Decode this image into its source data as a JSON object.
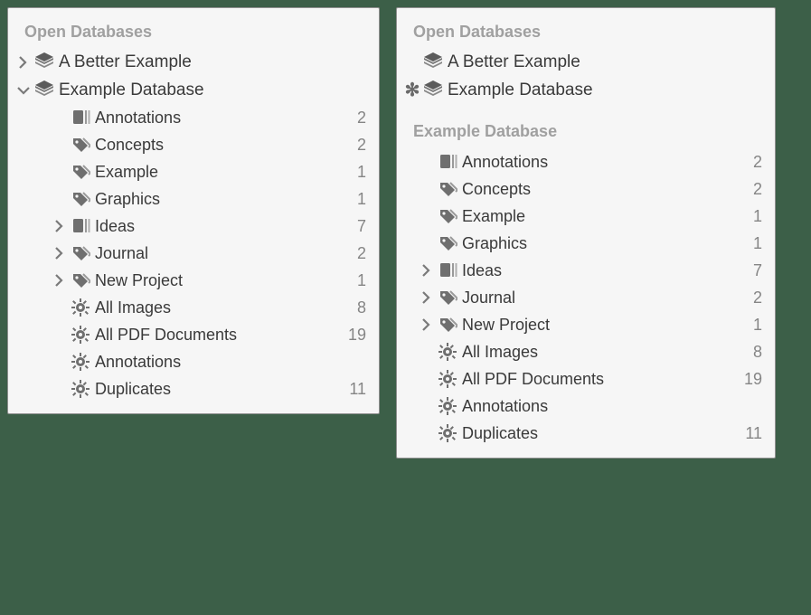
{
  "left": {
    "headers": {
      "open_databases": "Open Databases"
    },
    "databases": [
      {
        "label": "A Better Example",
        "disclosure": "right",
        "marker": ""
      },
      {
        "label": "Example Database",
        "disclosure": "down",
        "marker": ""
      }
    ],
    "items": [
      {
        "icon": "group",
        "label": "Annotations",
        "count": "2",
        "disclosure": "",
        "indent": 58
      },
      {
        "icon": "tag",
        "label": "Concepts",
        "count": "2",
        "disclosure": "",
        "indent": 58
      },
      {
        "icon": "tag",
        "label": "Example",
        "count": "1",
        "disclosure": "",
        "indent": 58
      },
      {
        "icon": "tag",
        "label": "Graphics",
        "count": "1",
        "disclosure": "",
        "indent": 58
      },
      {
        "icon": "group",
        "label": "Ideas",
        "count": "7",
        "disclosure": "right",
        "indent": 40
      },
      {
        "icon": "tag",
        "label": "Journal",
        "count": "2",
        "disclosure": "right",
        "indent": 40
      },
      {
        "icon": "tag",
        "label": "New Project",
        "count": "1",
        "disclosure": "right",
        "indent": 40
      },
      {
        "icon": "gear",
        "label": "All Images",
        "count": "8",
        "disclosure": "",
        "indent": 58
      },
      {
        "icon": "gear",
        "label": "All PDF Documents",
        "count": "19",
        "disclosure": "",
        "indent": 58
      },
      {
        "icon": "gear",
        "label": "Annotations",
        "count": "",
        "disclosure": "",
        "indent": 58
      },
      {
        "icon": "gear",
        "label": "Duplicates",
        "count": "11",
        "disclosure": "",
        "indent": 58
      }
    ]
  },
  "right": {
    "headers": {
      "open_databases": "Open Databases",
      "example_database": "Example Database"
    },
    "databases": [
      {
        "label": "A Better Example",
        "disclosure": "",
        "marker": ""
      },
      {
        "label": "Example Database",
        "disclosure": "",
        "marker": "✻"
      }
    ],
    "items": [
      {
        "icon": "group",
        "label": "Annotations",
        "count": "2",
        "disclosure": "",
        "indent": 34
      },
      {
        "icon": "tag",
        "label": "Concepts",
        "count": "2",
        "disclosure": "",
        "indent": 34
      },
      {
        "icon": "tag",
        "label": "Example",
        "count": "1",
        "disclosure": "",
        "indent": 34
      },
      {
        "icon": "tag",
        "label": "Graphics",
        "count": "1",
        "disclosure": "",
        "indent": 34
      },
      {
        "icon": "group",
        "label": "Ideas",
        "count": "7",
        "disclosure": "right",
        "indent": 16
      },
      {
        "icon": "tag",
        "label": "Journal",
        "count": "2",
        "disclosure": "right",
        "indent": 16
      },
      {
        "icon": "tag",
        "label": "New Project",
        "count": "1",
        "disclosure": "right",
        "indent": 16
      },
      {
        "icon": "gear",
        "label": "All Images",
        "count": "8",
        "disclosure": "",
        "indent": 34
      },
      {
        "icon": "gear",
        "label": "All PDF Documents",
        "count": "19",
        "disclosure": "",
        "indent": 34
      },
      {
        "icon": "gear",
        "label": "Annotations",
        "count": "",
        "disclosure": "",
        "indent": 34
      },
      {
        "icon": "gear",
        "label": "Duplicates",
        "count": "11",
        "disclosure": "",
        "indent": 34
      }
    ]
  }
}
